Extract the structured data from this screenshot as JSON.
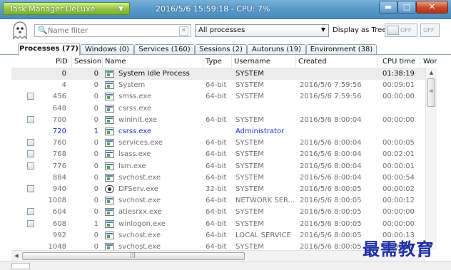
{
  "window": {
    "app_name": "Task Manager DeLuxe",
    "status": "2016/5/6 15:59:18 - CPU: 7%",
    "min_glyph": "▬",
    "max_glyph": "□",
    "close_glyph": "✕"
  },
  "toolbar": {
    "filter_placeholder": "Name filter",
    "process_scope": "All processes",
    "show_as_tree_label": "Display as Tree",
    "toggle1": "OFF",
    "toggle2": "OFF"
  },
  "tabs": [
    {
      "label": "Processes (77)",
      "active": true
    },
    {
      "label": "Windows (0)"
    },
    {
      "label": "Services (160)"
    },
    {
      "label": "Sessions (2)"
    },
    {
      "label": "Autoruns (19)"
    },
    {
      "label": "Environment (38)"
    }
  ],
  "columns": {
    "pid": "PID",
    "session": "Session",
    "name": "Name",
    "type": "Type",
    "username": "Username",
    "created": "Created",
    "cpu_time": "CPU time",
    "extra": "Worl"
  },
  "rows": [
    {
      "pid": "0",
      "session": "0",
      "name": "System Idle Process",
      "type": "",
      "user": "SYSTEM",
      "created": "",
      "cpu": "01:38:19",
      "check": false,
      "selected": true
    },
    {
      "pid": "4",
      "session": "0",
      "name": "System",
      "type": "64-bit",
      "user": "SYSTEM",
      "created": "2016/5/6 7:59:56",
      "cpu": "00:09:01",
      "check": false
    },
    {
      "pid": "456",
      "session": "0",
      "name": "smss.exe",
      "type": "64-bit",
      "user": "SYSTEM",
      "created": "2016/5/6 7:59:56",
      "cpu": "00:00:00",
      "check": true
    },
    {
      "pid": "648",
      "session": "0",
      "name": "csrss.exe",
      "type": "",
      "user": "",
      "created": "",
      "cpu": "",
      "check": false
    },
    {
      "pid": "700",
      "session": "0",
      "name": "wininit.exe",
      "type": "64-bit",
      "user": "SYSTEM",
      "created": "2016/5/6 8:00:04",
      "cpu": "00:00:00",
      "check": true
    },
    {
      "pid": "720",
      "session": "1",
      "name": "csrss.exe",
      "type": "",
      "user": "Administrator",
      "created": "",
      "cpu": "",
      "check": false,
      "user_row": true
    },
    {
      "pid": "760",
      "session": "0",
      "name": "services.exe",
      "type": "64-bit",
      "user": "SYSTEM",
      "created": "2016/5/6 8:00:04",
      "cpu": "00:00:05",
      "check": true
    },
    {
      "pid": "768",
      "session": "0",
      "name": "lsass.exe",
      "type": "64-bit",
      "user": "SYSTEM",
      "created": "2016/5/6 8:00:04",
      "cpu": "00:02:01",
      "check": true
    },
    {
      "pid": "776",
      "session": "0",
      "name": "lsm.exe",
      "type": "64-bit",
      "user": "SYSTEM",
      "created": "2016/5/6 8:00:04",
      "cpu": "00:00:01",
      "check": true
    },
    {
      "pid": "884",
      "session": "0",
      "name": "svchost.exe",
      "type": "64-bit",
      "user": "SYSTEM",
      "created": "2016/5/6 8:00:04",
      "cpu": "00:00:54",
      "check": false
    },
    {
      "pid": "940",
      "session": "0",
      "name": "DFServ.exe",
      "type": "32-bit",
      "user": "SYSTEM",
      "created": "2016/5/6 8:00:05",
      "cpu": "00:00:02",
      "check": true,
      "round_icon": true
    },
    {
      "pid": "1008",
      "session": "0",
      "name": "svchost.exe",
      "type": "64-bit",
      "user": "NETWORK SER...",
      "created": "2016/5/6 8:00:05",
      "cpu": "00:00:12",
      "check": false
    },
    {
      "pid": "604",
      "session": "0",
      "name": "atiesrxx.exe",
      "type": "64-bit",
      "user": "SYSTEM",
      "created": "2016/5/6 8:00:05",
      "cpu": "00:00:00",
      "check": true
    },
    {
      "pid": "608",
      "session": "1",
      "name": "winlogon.exe",
      "type": "64-bit",
      "user": "SYSTEM",
      "created": "2016/5/6 8:00:05",
      "cpu": "00:00:00",
      "check": true
    },
    {
      "pid": "992",
      "session": "0",
      "name": "svchost.exe",
      "type": "64-bit",
      "user": "LOCAL SERVICE",
      "created": "2016/5/6 8:00:05",
      "cpu": "00:00:13",
      "check": false
    },
    {
      "pid": "1048",
      "session": "0",
      "name": "svchost.exe",
      "type": "64-bit",
      "user": "SYSTEM",
      "created": "2016/5/6 8:00:05",
      "cpu": "00:00:00",
      "check": false
    }
  ],
  "watermark": "最需教育",
  "colors": {
    "title_bar": "#5b9bca",
    "app_button": "#92c33e",
    "selected_row": "#ececec",
    "user_process": "#1b2fd6"
  }
}
